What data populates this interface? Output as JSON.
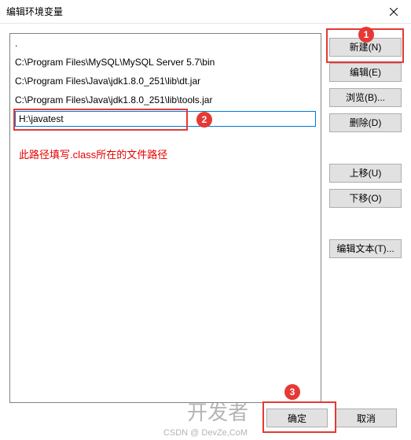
{
  "titlebar": {
    "title": "编辑环境变量"
  },
  "list": {
    "items": [
      ".",
      "C:\\Program Files\\MySQL\\MySQL Server 5.7\\bin",
      "C:\\Program Files\\Java\\jdk1.8.0_251\\lib\\dt.jar",
      "C:\\Program Files\\Java\\jdk1.8.0_251\\lib\\tools.jar"
    ],
    "editing_value": "H:\\javatest",
    "hint": "此路径填写.class所在的文件路径"
  },
  "buttons": {
    "new": "新建(N)",
    "edit": "编辑(E)",
    "browse": "浏览(B)...",
    "delete": "删除(D)",
    "moveup": "上移(U)",
    "movedown": "下移(O)",
    "edittext": "编辑文本(T)..."
  },
  "bottom": {
    "ok": "确定",
    "cancel": "取消"
  },
  "annotations": {
    "a1": "1",
    "a2": "2",
    "a3": "3"
  },
  "watermark": {
    "main": "开发者",
    "sub": "CSDN @ DevZe,CoM"
  }
}
